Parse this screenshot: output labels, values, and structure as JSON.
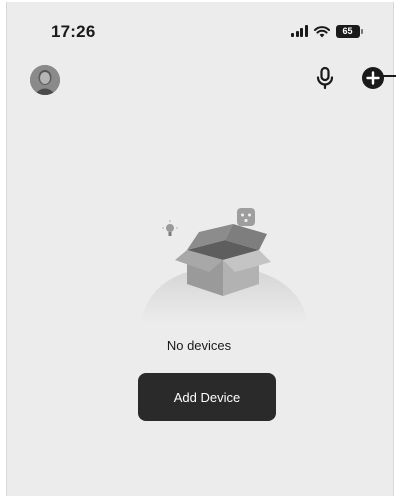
{
  "status_bar": {
    "time": "17:26",
    "battery": "65",
    "icons": [
      "cellular-signal-icon",
      "wifi-icon",
      "battery-icon"
    ]
  },
  "header": {
    "icons": [
      "avatar-icon",
      "microphone-icon",
      "add-circle-icon"
    ]
  },
  "empty_state": {
    "illustration": "empty-box-illustration",
    "message": "No devices",
    "button_label": "Add Device"
  },
  "colors": {
    "background": "#ececec",
    "button": "#2a2a2a",
    "text": "#1a1a1a"
  }
}
